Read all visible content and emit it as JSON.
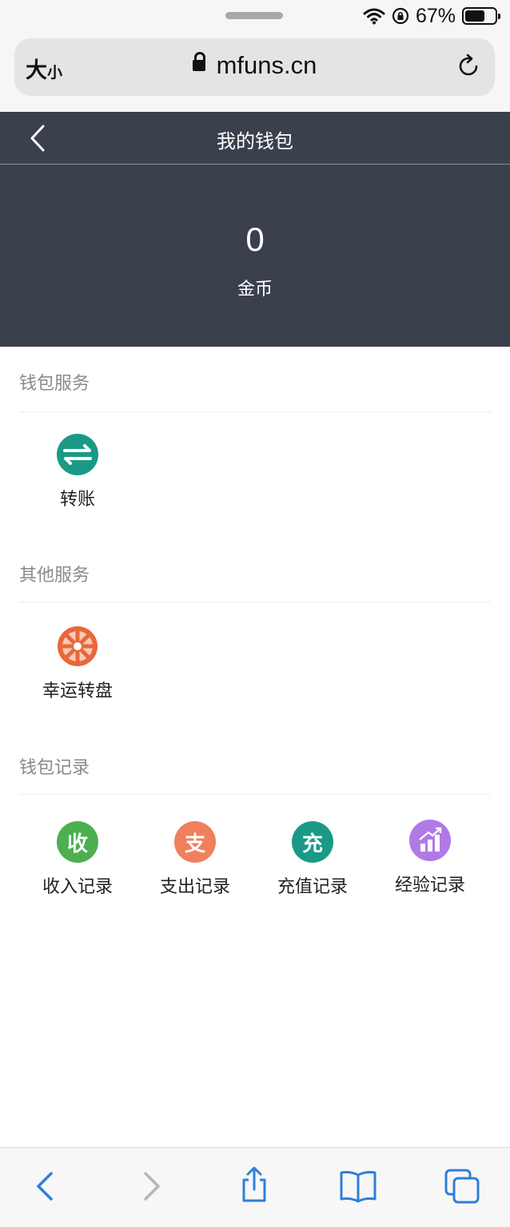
{
  "status_bar": {
    "battery_text": "67%",
    "battery_level": 0.67
  },
  "browser": {
    "text_size_label": "大",
    "text_size_small": "小",
    "url": "mfuns.cn"
  },
  "header": {
    "title": "我的钱包"
  },
  "balance": {
    "value": "0",
    "unit": "金币"
  },
  "sections": {
    "wallet_services": {
      "title": "钱包服务",
      "items": [
        {
          "label": "转账",
          "icon": "transfer-icon",
          "color": "#1a9a86"
        }
      ]
    },
    "other_services": {
      "title": "其他服务",
      "items": [
        {
          "label": "幸运转盘",
          "icon": "wheel-icon",
          "color": "#e8673c"
        }
      ]
    },
    "wallet_records": {
      "title": "钱包记录",
      "items": [
        {
          "label": "收入记录",
          "glyph": "收",
          "color": "#4caf50"
        },
        {
          "label": "支出记录",
          "glyph": "支",
          "color": "#f0805c"
        },
        {
          "label": "充值记录",
          "glyph": "充",
          "color": "#1a9a86"
        },
        {
          "label": "经验记录",
          "icon": "chart-icon",
          "color": "#b07ae6"
        }
      ]
    }
  },
  "colors": {
    "header_bg": "#3b404d",
    "browser_tint": "#2e7fd9"
  }
}
